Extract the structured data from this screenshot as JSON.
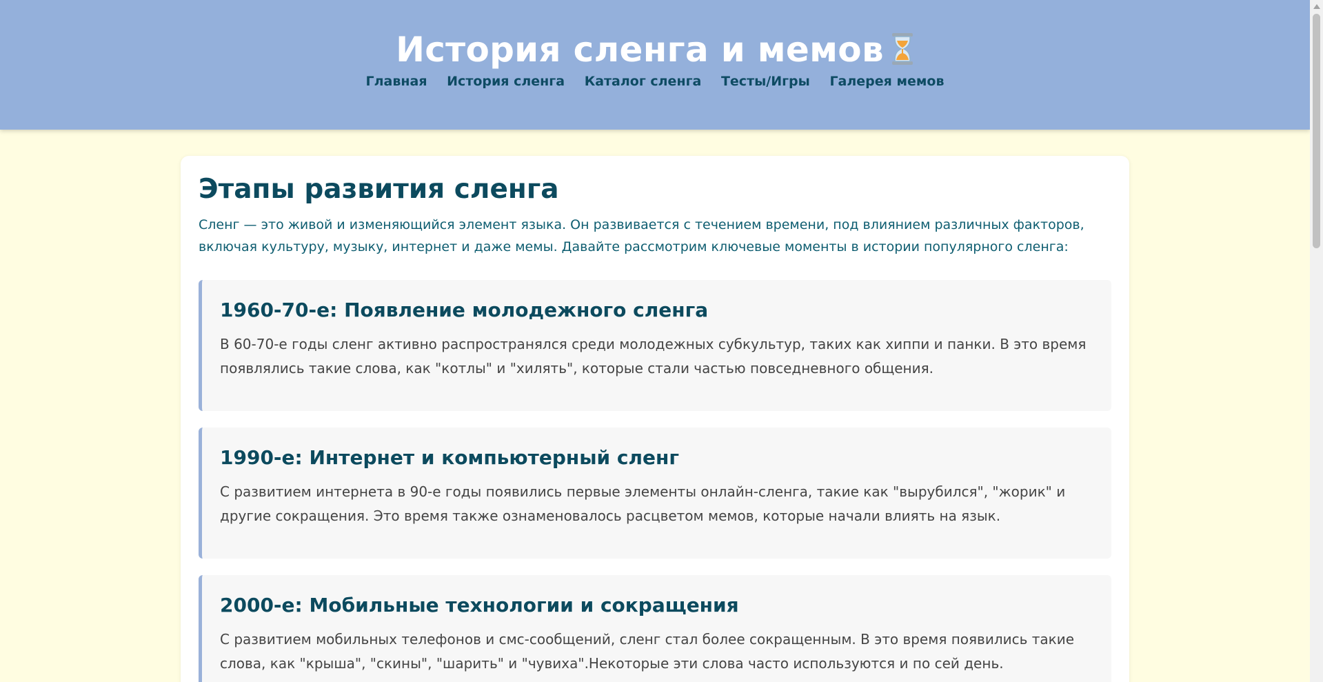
{
  "header": {
    "title": "История сленга и мемов",
    "title_icon": "hourglass-icon",
    "nav": [
      {
        "label": "Главная"
      },
      {
        "label": "История сленга"
      },
      {
        "label": "Каталог сленга"
      },
      {
        "label": "Тесты/Игры"
      },
      {
        "label": "Галерея мемов"
      }
    ]
  },
  "main": {
    "heading": "Этапы развития сленга",
    "intro": "Сленг — это живой и изменяющийся элемент языка. Он развивается с течением времени, под влиянием различных факторов, включая культуру, музыку, интернет и даже мемы. Давайте рассмотрим ключевые моменты в истории популярного сленга:",
    "stages": [
      {
        "title": "1960-70-е: Появление молодежного сленга",
        "text": "В 60-70-е годы сленг активно распространялся среди молодежных субкультур, таких как хиппи и панки. В это время появлялись такие слова, как \"котлы\" и \"хилять\", которые стали частью повседневного общения."
      },
      {
        "title": "1990-е: Интернет и компьютерный сленг",
        "text": "С развитием интернета в 90-е годы появились первые элементы онлайн-сленга, такие как \"вырубился\", \"жорик\" и другие сокращения. Это время также ознаменовалось расцветом мемов, которые начали влиять на язык."
      },
      {
        "title": "2000-е: Мобильные технологии и сокращения",
        "text": "С развитием мобильных телефонов и смс-сообщений, сленг стал более сокращенным. В это время появились такие слова, как \"крыша\", \"скины\", \"шарить\" и \"чувиха\".Некоторые эти слова часто используются и по сей день."
      }
    ]
  },
  "colors": {
    "header_bg": "#94b0db",
    "page_bg": "#fffde1",
    "accent_text": "#0c4a5e",
    "stage_border": "#9ab1d9"
  }
}
